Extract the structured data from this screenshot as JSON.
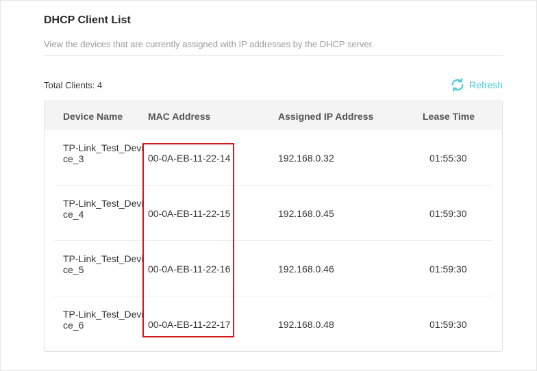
{
  "header": {
    "title": "DHCP Client List",
    "description": "View the devices that are currently assigned with IP addresses by the DHCP server."
  },
  "summary": {
    "total_clients": "Total Clients: 4",
    "refresh_label": "Refresh",
    "refresh_icon": "refresh-icon"
  },
  "table": {
    "columns": [
      "Device Name",
      "MAC Address",
      "Assigned IP Address",
      "Lease Time"
    ],
    "rows": [
      {
        "device_name": "TP-Link_Test_Device_3",
        "mac": "00-0A-EB-11-22-14",
        "ip": "192.168.0.32",
        "lease": "01:55:30"
      },
      {
        "device_name": "TP-Link_Test_Device_4",
        "mac": "00-0A-EB-11-22-15",
        "ip": "192.168.0.45",
        "lease": "01:59:30"
      },
      {
        "device_name": "TP-Link_Test_Device_5",
        "mac": "00-0A-EB-11-22-16",
        "ip": "192.168.0.46",
        "lease": "01:59:30"
      },
      {
        "device_name": "TP-Link_Test_Device_6",
        "mac": "00-0A-EB-11-22-17",
        "ip": "192.168.0.48",
        "lease": "01:59:30"
      }
    ]
  },
  "colors": {
    "accent": "#4acbd6",
    "highlight": "#d11a1a",
    "header_bg": "#f4f4f4"
  }
}
